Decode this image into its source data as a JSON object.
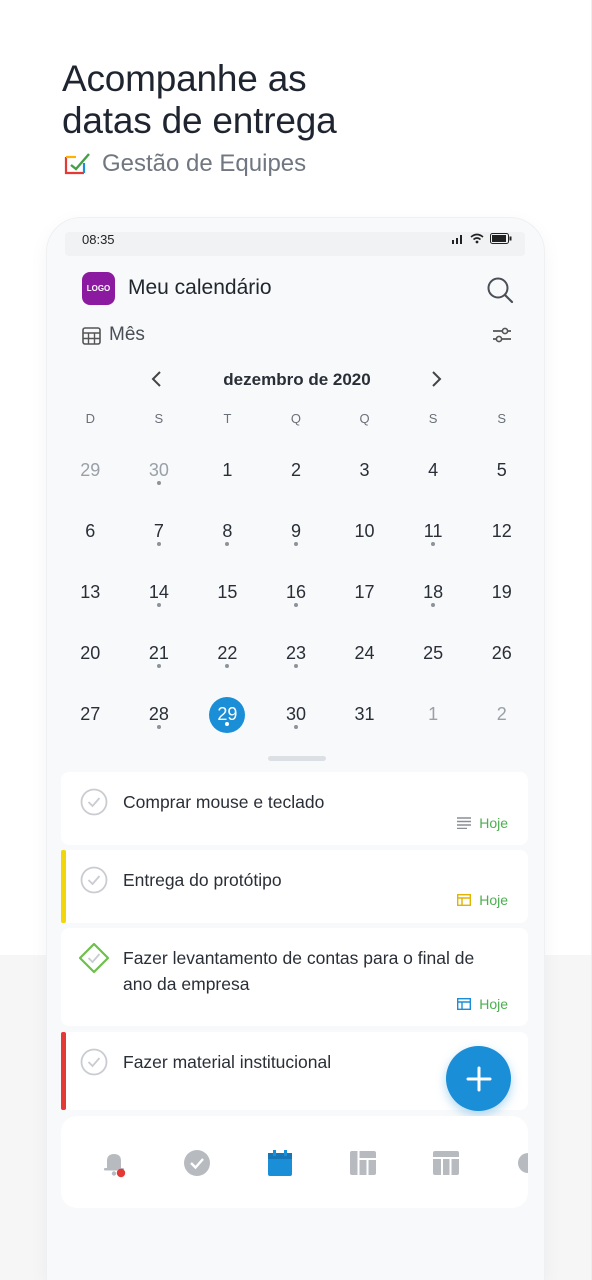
{
  "headline": {
    "line1": "Acompanhe as",
    "line2": "datas de entrega"
  },
  "brand": {
    "name": "Gestão de Equipes",
    "icon": "checkbox-brand-icon"
  },
  "status_bar": {
    "time": "08:35"
  },
  "app": {
    "logo_text": "LOGO",
    "title": "Meu calendário",
    "view_mode": "Mês"
  },
  "calendar": {
    "month_label": "dezembro de 2020",
    "weekdays": [
      "D",
      "S",
      "T",
      "Q",
      "Q",
      "S",
      "S"
    ],
    "days": [
      {
        "n": "29",
        "muted": true,
        "dot": false
      },
      {
        "n": "30",
        "muted": true,
        "dot": true
      },
      {
        "n": "1",
        "dot": false
      },
      {
        "n": "2",
        "dot": false
      },
      {
        "n": "3",
        "dot": false
      },
      {
        "n": "4",
        "dot": false
      },
      {
        "n": "5",
        "dot": false
      },
      {
        "n": "6",
        "dot": false
      },
      {
        "n": "7",
        "dot": true
      },
      {
        "n": "8",
        "dot": true
      },
      {
        "n": "9",
        "dot": true
      },
      {
        "n": "10",
        "dot": false
      },
      {
        "n": "11",
        "dot": true
      },
      {
        "n": "12",
        "dot": false
      },
      {
        "n": "13",
        "dot": false
      },
      {
        "n": "14",
        "dot": true
      },
      {
        "n": "15",
        "dot": false
      },
      {
        "n": "16",
        "dot": true
      },
      {
        "n": "17",
        "dot": false
      },
      {
        "n": "18",
        "dot": true
      },
      {
        "n": "19",
        "dot": false
      },
      {
        "n": "20",
        "dot": false
      },
      {
        "n": "21",
        "dot": true
      },
      {
        "n": "22",
        "dot": true
      },
      {
        "n": "23",
        "dot": true
      },
      {
        "n": "24",
        "dot": false
      },
      {
        "n": "25",
        "dot": false
      },
      {
        "n": "26",
        "dot": false
      },
      {
        "n": "27",
        "dot": false
      },
      {
        "n": "28",
        "dot": true
      },
      {
        "n": "29",
        "dot": true,
        "selected": true
      },
      {
        "n": "30",
        "dot": true
      },
      {
        "n": "31",
        "dot": false
      },
      {
        "n": "1",
        "muted": true,
        "dot": false
      },
      {
        "n": "2",
        "muted": true,
        "dot": false
      }
    ]
  },
  "tasks": [
    {
      "title": "Comprar mouse e teclado",
      "due": "Hoje",
      "due_icon": "lines-icon",
      "bar_color": "",
      "check": "circle"
    },
    {
      "title": "Entrega do protótipo",
      "due": "Hoje",
      "due_icon": "board-icon",
      "bar_color": "#f2d60c",
      "check": "circle"
    },
    {
      "title": "Fazer levantamento de contas para o final de ano da empresa",
      "due": "Hoje",
      "due_icon": "board-icon",
      "bar_color": "",
      "check": "diamond"
    },
    {
      "title": "Fazer material institucional",
      "due": "",
      "due_icon": "",
      "bar_color": "#e53935",
      "check": "circle"
    }
  ],
  "colors": {
    "accent": "#1a8ed6",
    "due_green": "#4caf50",
    "logo_purple": "#8c1aa0",
    "notification_red": "#e53935"
  },
  "nav": [
    "bell-icon",
    "check-circle-icon",
    "calendar-icon",
    "kanban-icon",
    "table-icon",
    "chart-icon"
  ]
}
